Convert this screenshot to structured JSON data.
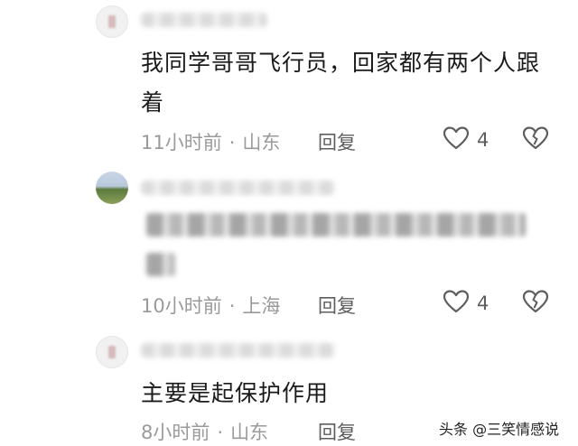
{
  "comments": [
    {
      "content": [
        "我同学哥哥飞行员，回家都有两个人跟",
        "着"
      ],
      "time": "11小时前",
      "location": "山东",
      "reply_label": "回复",
      "likes": "4"
    },
    {
      "time": "10小时前",
      "location": "上海",
      "reply_label": "回复",
      "likes": "4"
    },
    {
      "content": [
        "主要是起保护作用"
      ],
      "time": "8小时前",
      "location": "山东",
      "reply_label": "回复"
    }
  ],
  "meta_separator": "·",
  "watermark": "头条 @三笑情感说"
}
